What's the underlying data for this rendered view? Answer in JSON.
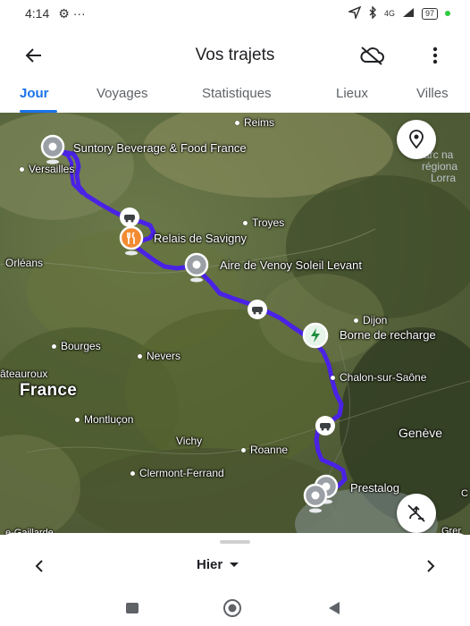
{
  "status_bar": {
    "time": "4:14",
    "left_icons": "⚙ ···",
    "network": "4G",
    "battery": "97"
  },
  "header": {
    "title": "Vos trajets"
  },
  "tabs": [
    {
      "label": "Jour",
      "active": true
    },
    {
      "label": "Voyages",
      "active": false
    },
    {
      "label": "Statistiques",
      "active": false
    },
    {
      "label": "Lieux",
      "active": false
    },
    {
      "label": "Villes",
      "active": false
    }
  ],
  "map": {
    "cities": {
      "reims": "Reims",
      "versailles": "Versailles",
      "troyes": "Troyes",
      "orleans": "Orléans",
      "dijon": "Dijon",
      "bourges": "Bourges",
      "nevers": "Nevers",
      "chateauroux": "âteauroux",
      "france": "France",
      "chalon": "Chalon-sur-Saône",
      "montlucon": "Montluçon",
      "vichy": "Vichy",
      "roanne": "Roanne",
      "clermont": "Clermont-Ferrand",
      "geneve": "Genève",
      "parc_1": "Parc na",
      "parc_2": "régiona",
      "parc_3": "Lorra",
      "edge_left": "e-Gaillarde",
      "edge_right": "Grer",
      "edge_right_c": "C"
    },
    "stops": {
      "suntory": "Suntory Beverage & Food France",
      "relais": "Relais de Savigny",
      "venoy": "Aire de Venoy Soleil Levant",
      "borne": "Borne de recharge",
      "prestalog": "Prestalog"
    },
    "route_color": "#4a22e6"
  },
  "bottom": {
    "date_label": "Hier"
  }
}
